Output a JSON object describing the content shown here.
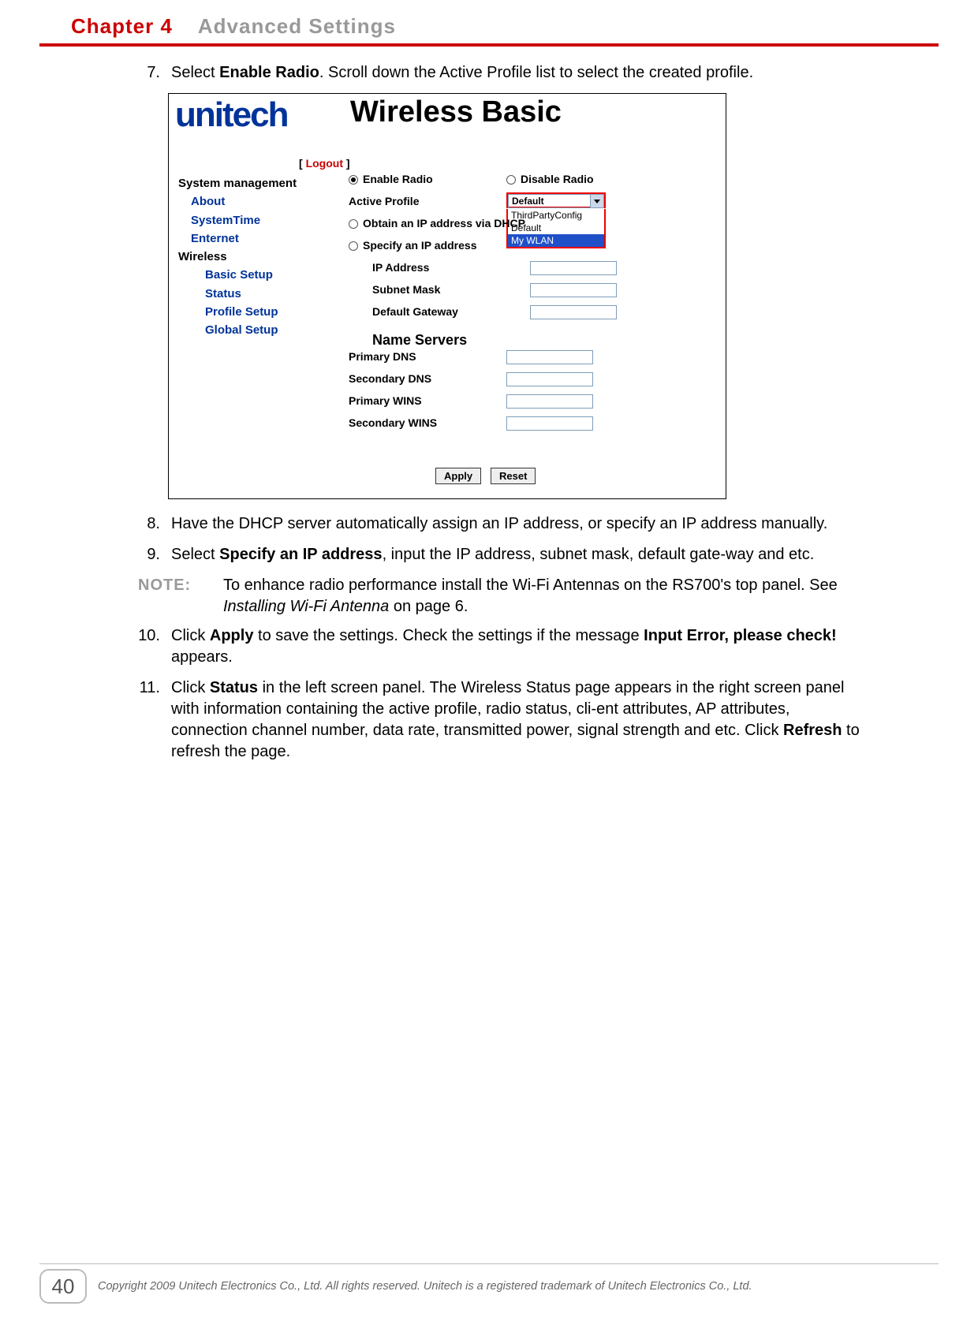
{
  "header": {
    "chapter": "Chapter 4",
    "title": "Advanced Settings"
  },
  "steps": {
    "s7": {
      "num": "7.",
      "t1": "Select ",
      "b1": "Enable Radio",
      "t2": ". Scroll down the Active Profile list to select the created profile."
    },
    "s8": {
      "num": "8.",
      "t1": "Have the DHCP server automatically assign an IP address, or specify an IP address manually."
    },
    "s9": {
      "num": "9.",
      "t1": "Select ",
      "b1": "Specify an IP address",
      "t2": ", input the IP address, subnet mask, default gate-way and etc."
    },
    "note": {
      "lbl": "NOTE:",
      "t1": "To enhance radio performance install the Wi-Fi Antennas on the RS700's top panel. See ",
      "i1": "Installing Wi-Fi Antenna",
      "t2": " on page 6."
    },
    "s10": {
      "num": "10.",
      "t1": "Click ",
      "b1": "Apply",
      "t2": " to save the settings. Check the settings if the message ",
      "b2": "Input Error, please check!",
      "t3": " appears."
    },
    "s11": {
      "num": "11.",
      "t1": "Click ",
      "b1": "Status",
      "t2": " in the left screen panel. The Wireless Status page appears in the right screen panel with information containing the active profile, radio status, cli-ent attributes, AP attributes, connection channel number, data rate, transmitted power, signal strength and etc. Click ",
      "b2": "Refresh",
      "t3": " to refresh the page."
    }
  },
  "shot": {
    "brand": "unitech",
    "title": "Wireless Basic",
    "logout_l": "[ ",
    "logout_t": "Logout",
    "logout_r": " ]",
    "menu": {
      "sys": "System management",
      "about": "About",
      "systime": "SystemTime",
      "enternet": "Enternet",
      "wireless": "Wireless",
      "basic": "Basic Setup",
      "status": "Status",
      "profile": "Profile Setup",
      "global": "Global Setup"
    },
    "form": {
      "enable": "Enable Radio",
      "disable": "Disable Radio",
      "active": "Active Profile",
      "dhcp": "Obtain an IP address via DHCP",
      "spec": "Specify an IP address",
      "ip": "IP Address",
      "mask": "Subnet Mask",
      "gw": "Default Gateway",
      "ns": "Name Servers",
      "pdns": "Primary DNS",
      "sdns": "Secondary DNS",
      "pwins": "Primary WINS",
      "swins": "Secondary WINS",
      "sel_val": "Default",
      "opt1": "ThirdPartyConfig",
      "opt2": "Default",
      "opt3": "My WLAN",
      "apply": "Apply",
      "reset": "Reset"
    }
  },
  "footer": {
    "page": "40",
    "copy": "Copyright 2009 Unitech Electronics Co., Ltd. All rights reserved. Unitech is a registered trademark of Unitech Electronics Co., Ltd."
  }
}
